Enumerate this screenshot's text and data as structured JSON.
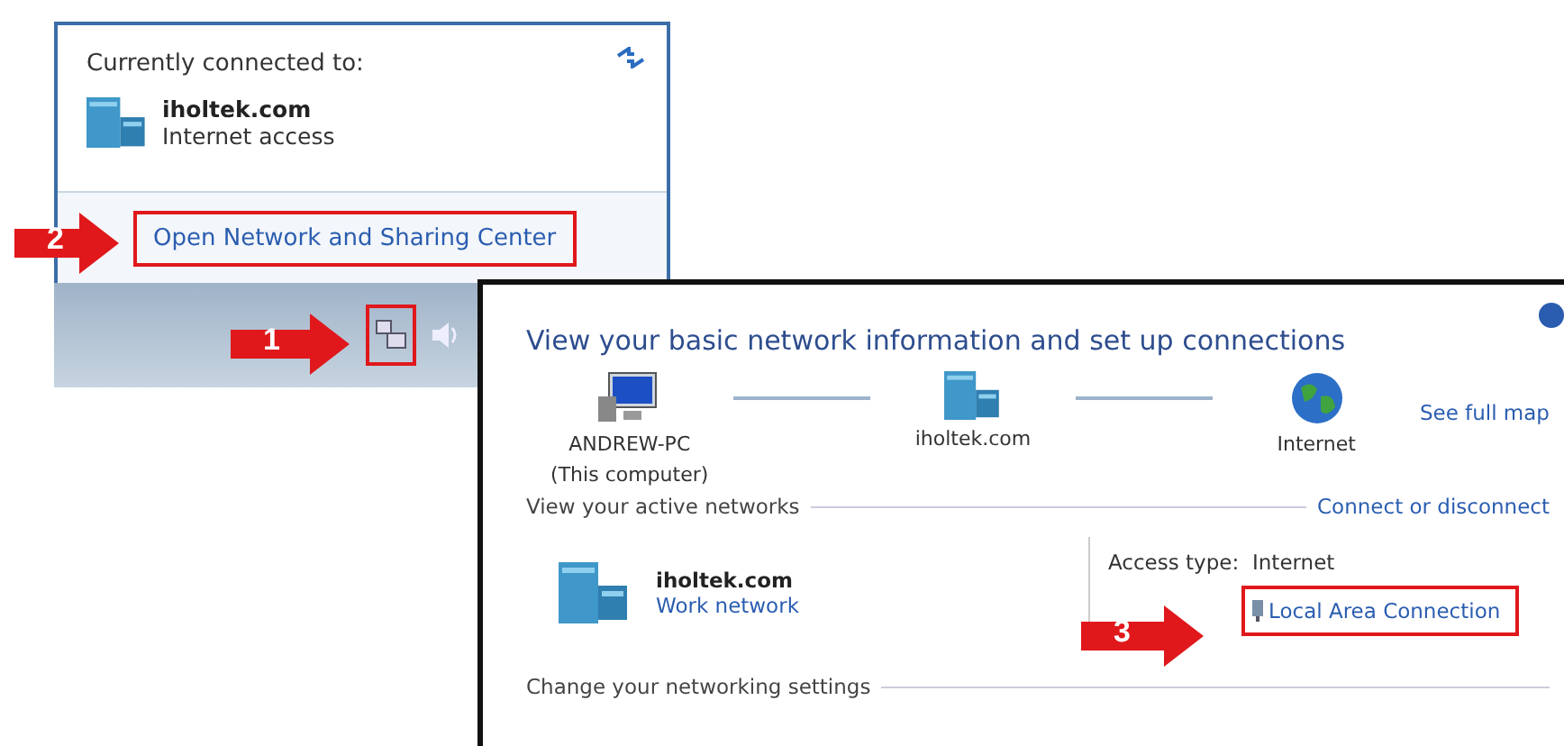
{
  "popup": {
    "heading": "Currently connected to:",
    "network": {
      "name": "iholtek.com",
      "status": "Internet access"
    },
    "link": "Open Network and Sharing Center"
  },
  "callouts": [
    {
      "number": "1"
    },
    {
      "number": "2"
    },
    {
      "number": "3"
    }
  ],
  "window": {
    "title": "View your basic network information and set up connections",
    "map": [
      {
        "kind": "computer",
        "label": "ANDREW-PC",
        "sublabel": "(This computer)"
      },
      {
        "kind": "network",
        "label": "iholtek.com"
      },
      {
        "kind": "globe",
        "label": "Internet"
      }
    ],
    "see_full_map": "See full map",
    "active_heading": "View your active networks",
    "active_action": "Connect or disconnect",
    "network": {
      "name": "iholtek.com",
      "type": "Work network"
    },
    "details": [
      {
        "kind": "text",
        "label": "Access type:",
        "value": "Internet"
      },
      {
        "kind": "link",
        "value": "Local Area Connection"
      }
    ],
    "settings_heading": "Change your networking settings"
  }
}
